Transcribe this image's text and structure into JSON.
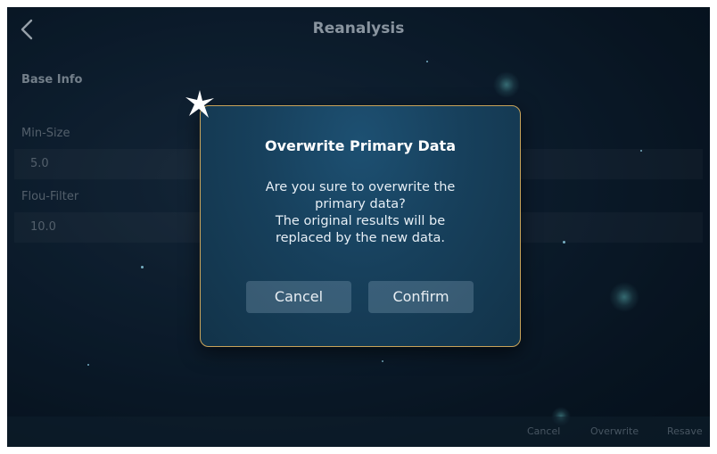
{
  "header": {
    "title": "Reanalysis",
    "back_icon": "chevron-left-icon"
  },
  "base_info": {
    "section_label": "Base Info",
    "fields": [
      {
        "label": "Min-Size",
        "value": "5.0"
      },
      {
        "label": "Flou-Filter",
        "value": "10.0"
      }
    ]
  },
  "bottom_bar": {
    "cancel": "Cancel",
    "overwrite": "Overwrite",
    "resave": "Resave"
  },
  "dialog": {
    "title": "Overwrite Primary Data",
    "message_lines": [
      "Are you sure to overwrite the",
      "primary data?",
      "The original results will be",
      "replaced by the new data."
    ],
    "cancel_label": "Cancel",
    "confirm_label": "Confirm",
    "decoration_icon": "sparkle-icon"
  },
  "colors": {
    "dialog_border": "#c8a35a",
    "dialog_bg": "#17405c",
    "background": "#0f2133"
  }
}
